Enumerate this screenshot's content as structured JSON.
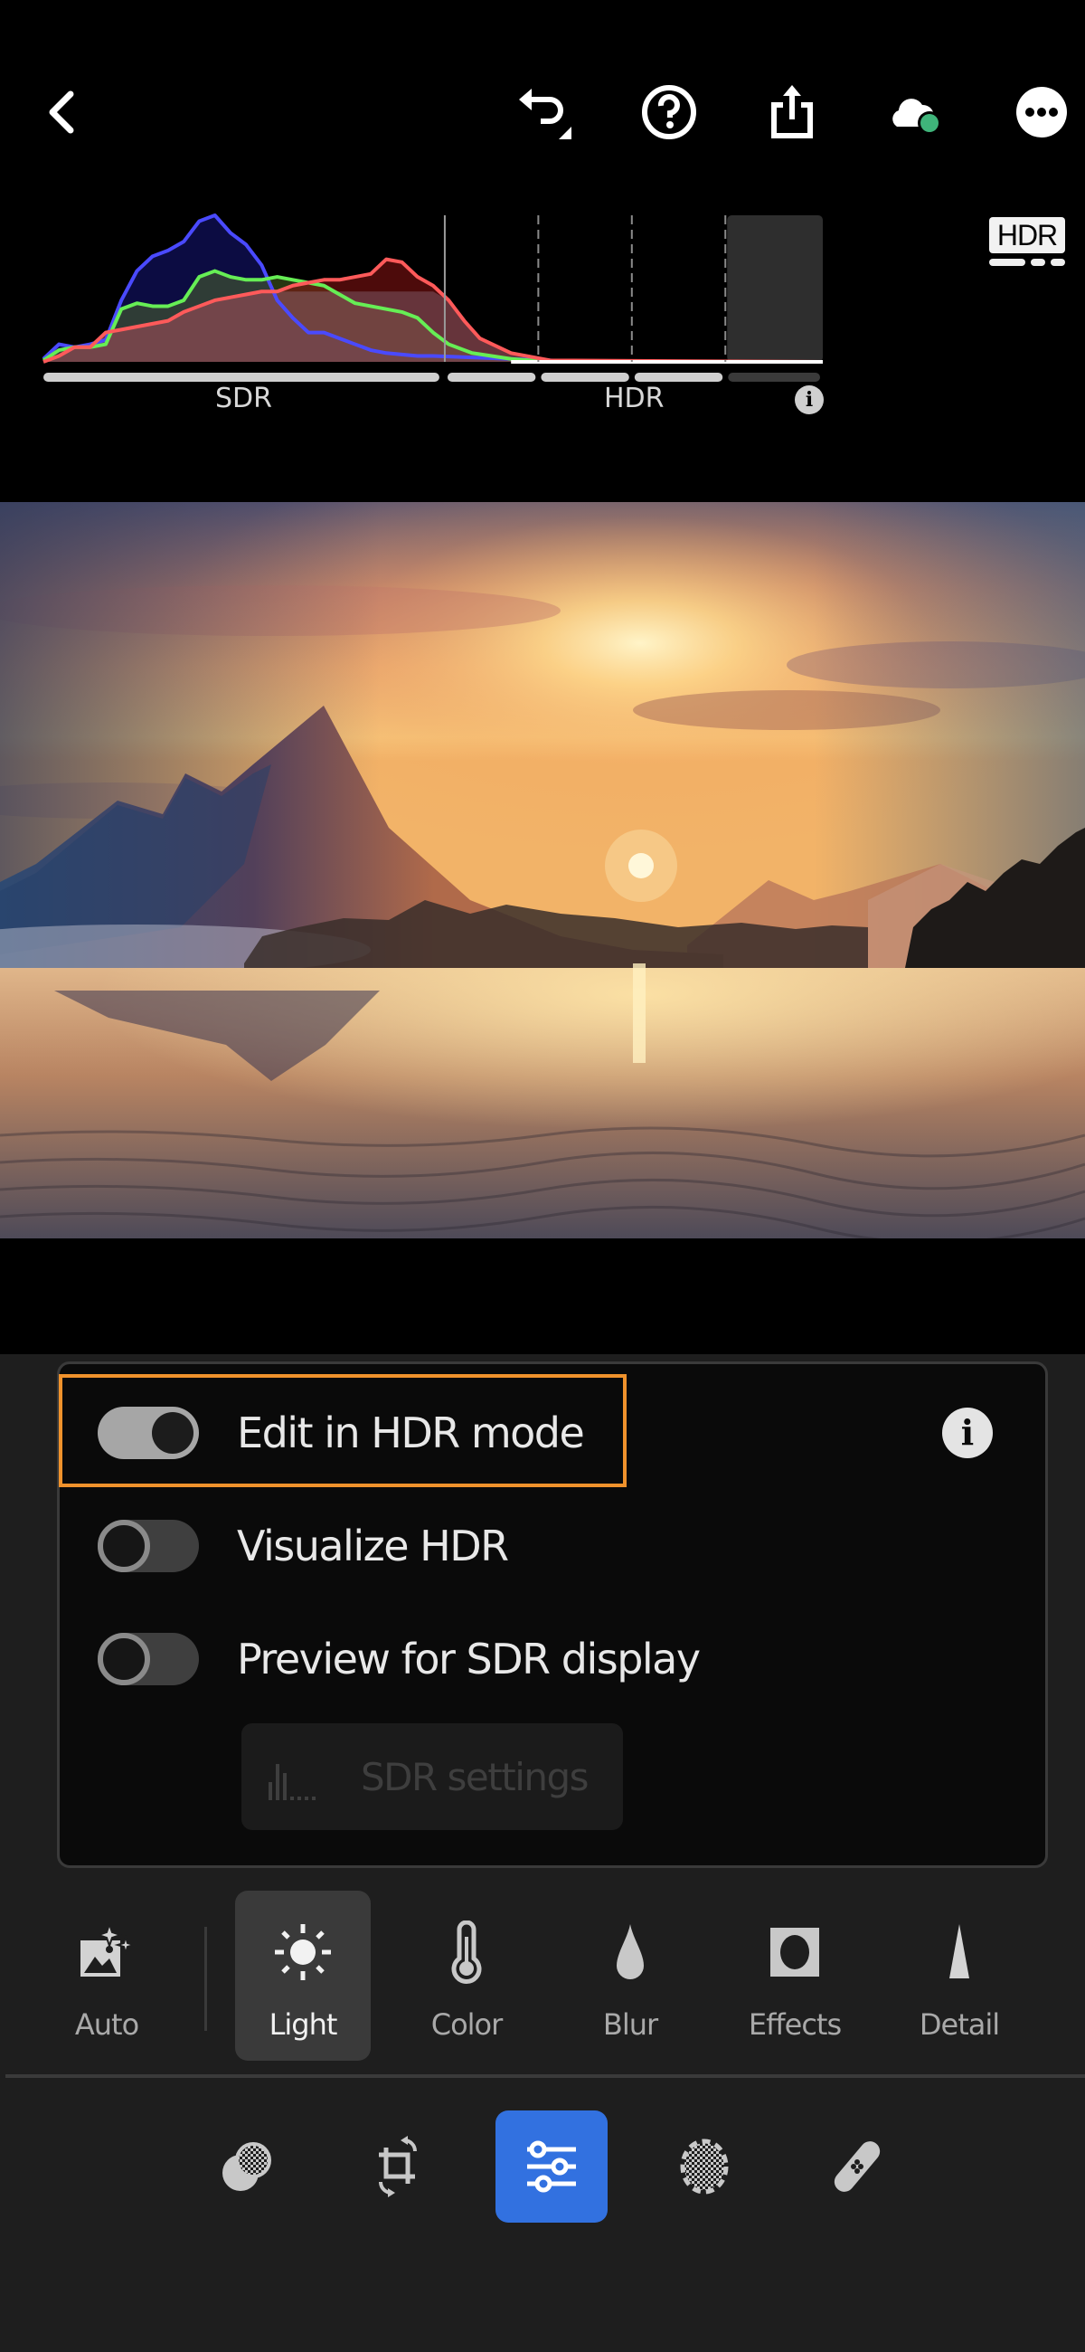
{
  "topbar": {
    "back": {
      "icon": "chevron-left-icon"
    },
    "actions": [
      {
        "name": "undo",
        "icon": "undo-icon"
      },
      {
        "name": "help",
        "icon": "help-icon"
      },
      {
        "name": "share",
        "icon": "share-icon"
      },
      {
        "name": "cloud-sync",
        "icon": "cloud-sync-icon",
        "status_color": "#3fb47a"
      },
      {
        "name": "more",
        "icon": "more-icon"
      }
    ]
  },
  "histogram": {
    "badge": "HDR",
    "sdr_label": "SDR",
    "hdr_label": "HDR",
    "info_glyph": "i",
    "chart_data": {
      "type": "area",
      "title": "",
      "xlabel": "",
      "ylabel": "",
      "x_regions": [
        "SDR",
        "HDR"
      ],
      "xlim": [
        0,
        1
      ],
      "ylim": [
        0,
        1
      ],
      "sdr_boundary": 0.515,
      "hdr_stops": [
        0.635,
        0.755,
        0.875
      ],
      "headroom_region": [
        0.875,
        1.0
      ],
      "series": [
        {
          "name": "Blue",
          "color": "#4a4aff",
          "x": [
            0.0,
            0.02,
            0.04,
            0.06,
            0.08,
            0.1,
            0.12,
            0.14,
            0.16,
            0.18,
            0.2,
            0.22,
            0.24,
            0.26,
            0.28,
            0.3,
            0.32,
            0.34,
            0.36,
            0.38,
            0.4,
            0.42,
            0.44,
            0.46,
            0.48,
            0.5,
            0.55,
            0.6,
            0.65,
            0.7,
            1.0
          ],
          "values": [
            0.02,
            0.12,
            0.1,
            0.12,
            0.15,
            0.42,
            0.62,
            0.72,
            0.76,
            0.82,
            0.96,
            1.0,
            0.88,
            0.8,
            0.66,
            0.42,
            0.3,
            0.2,
            0.2,
            0.16,
            0.12,
            0.08,
            0.06,
            0.05,
            0.04,
            0.04,
            0.03,
            0.02,
            0.01,
            0.0,
            0.0
          ]
        },
        {
          "name": "Green",
          "color": "#66ee55",
          "x": [
            0.0,
            0.02,
            0.04,
            0.06,
            0.08,
            0.1,
            0.12,
            0.14,
            0.16,
            0.18,
            0.2,
            0.22,
            0.24,
            0.26,
            0.28,
            0.3,
            0.32,
            0.34,
            0.36,
            0.38,
            0.4,
            0.42,
            0.44,
            0.46,
            0.48,
            0.5,
            0.52,
            0.55,
            0.6,
            0.65,
            1.0
          ],
          "values": [
            0.01,
            0.08,
            0.1,
            0.1,
            0.12,
            0.36,
            0.4,
            0.38,
            0.38,
            0.42,
            0.58,
            0.62,
            0.58,
            0.56,
            0.56,
            0.58,
            0.56,
            0.54,
            0.52,
            0.46,
            0.4,
            0.38,
            0.36,
            0.34,
            0.3,
            0.2,
            0.12,
            0.06,
            0.02,
            0.0,
            0.0
          ]
        },
        {
          "name": "Red",
          "color": "#ff5a5a",
          "x": [
            0.0,
            0.02,
            0.04,
            0.06,
            0.08,
            0.1,
            0.12,
            0.14,
            0.16,
            0.18,
            0.2,
            0.22,
            0.24,
            0.26,
            0.28,
            0.3,
            0.32,
            0.34,
            0.36,
            0.38,
            0.4,
            0.42,
            0.44,
            0.46,
            0.48,
            0.5,
            0.52,
            0.54,
            0.56,
            0.6,
            0.65,
            1.0
          ],
          "values": [
            0.0,
            0.04,
            0.1,
            0.1,
            0.2,
            0.22,
            0.24,
            0.26,
            0.28,
            0.34,
            0.38,
            0.42,
            0.44,
            0.46,
            0.48,
            0.48,
            0.52,
            0.54,
            0.56,
            0.56,
            0.58,
            0.6,
            0.7,
            0.68,
            0.58,
            0.52,
            0.42,
            0.28,
            0.16,
            0.06,
            0.01,
            0.0
          ]
        }
      ]
    }
  },
  "hdr_panel": {
    "toggles": [
      {
        "label": "Edit in HDR mode",
        "on": true
      },
      {
        "label": "Visualize HDR",
        "on": false
      },
      {
        "label": "Preview for SDR display",
        "on": false
      }
    ],
    "info_glyph": "i",
    "sdr_settings": {
      "label": "SDR settings",
      "disabled": true
    },
    "highlight_color": "#f0922c"
  },
  "tool_tabs": {
    "items": [
      {
        "label": "Auto",
        "icon": "auto-enhance-icon",
        "active": false
      },
      {
        "label": "Light",
        "icon": "sun-icon",
        "active": true
      },
      {
        "label": "Color",
        "icon": "thermometer-icon",
        "active": false
      },
      {
        "label": "Blur",
        "icon": "droplet-icon",
        "active": false
      },
      {
        "label": "Effects",
        "icon": "vignette-icon",
        "active": false
      },
      {
        "label": "Detail",
        "icon": "triangle-icon",
        "active": false
      }
    ]
  },
  "bottom_toolbar": {
    "items": [
      {
        "name": "presets",
        "icon": "presets-icon",
        "active": false
      },
      {
        "name": "crop",
        "icon": "crop-rotate-icon",
        "active": false
      },
      {
        "name": "edit",
        "icon": "sliders-icon",
        "active": true
      },
      {
        "name": "masking",
        "icon": "masking-icon",
        "active": false
      },
      {
        "name": "healing",
        "icon": "bandage-icon",
        "active": false
      }
    ],
    "accent_color": "#3271e0"
  }
}
